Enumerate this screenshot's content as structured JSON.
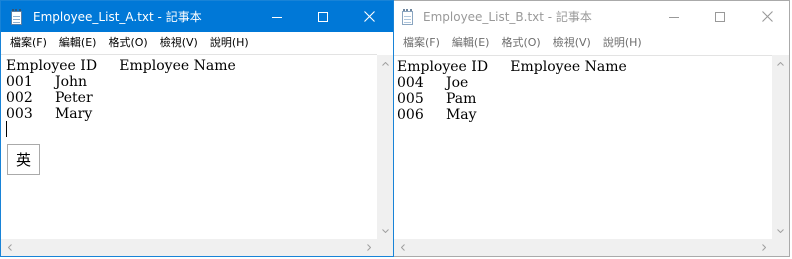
{
  "window_a": {
    "title": "Employee_List_A.txt - 記事本",
    "menu": [
      "檔案(F)",
      "編輯(E)",
      "格式(O)",
      "檢視(V)",
      "說明(H)"
    ],
    "lines": [
      "Employee ID     Employee Name",
      "001     John",
      "002     Peter",
      "003     Mary"
    ],
    "ime_indicator": "英"
  },
  "window_b": {
    "title": "Employee_List_B.txt - 記事本",
    "menu": [
      "檔案(F)",
      "編輯(E)",
      "格式(O)",
      "檢視(V)",
      "說明(H)"
    ],
    "lines": [
      "Employee ID     Employee Name",
      "004     Joe",
      "005     Pam",
      "006     May"
    ]
  },
  "colors": {
    "active_titlebar": "#0078d7",
    "inactive_title_text": "#999999",
    "scrollbar_track": "#f0f0f0"
  }
}
